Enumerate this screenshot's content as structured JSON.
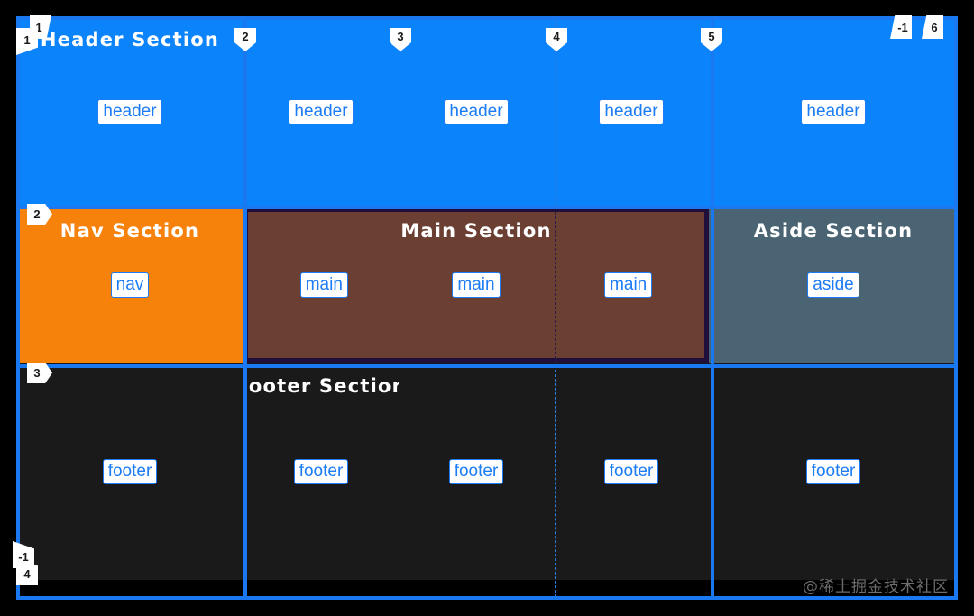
{
  "overlay": {
    "type": "css-grid-devtools-highlighter",
    "line_color": "#1a78f0",
    "label_bg": "#ffffff",
    "label_text_color": "#1a1a1a",
    "dashed_line_color": "#2a7de0"
  },
  "colors": {
    "page_background": "#000000",
    "header": "#0b84fb",
    "nav": "#f7820b",
    "main": "#6b4033",
    "main_border": "#1f0f3a",
    "aside": "#4a6473",
    "footer": "#1a1a1a",
    "badge_text": "#1c7cf5",
    "watermark": "#6e6e6e"
  },
  "sections": {
    "header": {
      "title": "Header Section",
      "area_name": "header",
      "cell_count": 5
    },
    "nav": {
      "title": "Nav Section",
      "area_name": "nav",
      "cell_count": 1
    },
    "main": {
      "title": "Main Section",
      "area_name": "main",
      "cell_count": 3
    },
    "aside": {
      "title": "Aside Section",
      "area_name": "aside",
      "cell_count": 1
    },
    "footer": {
      "title": "Footer Section",
      "area_name": "footer",
      "cell_count": 5
    }
  },
  "grid_lines": {
    "column_labels_top": [
      "1",
      "2",
      "3",
      "4",
      "5",
      "6"
    ],
    "column_label_negative_top_right": "-1",
    "column_label_negative_bottom_left": "-1",
    "row_labels_left": [
      "1",
      "2",
      "3",
      "4"
    ],
    "columns": 5,
    "rows": 3
  },
  "watermark": {
    "text": "@稀土掘金技术社区"
  }
}
